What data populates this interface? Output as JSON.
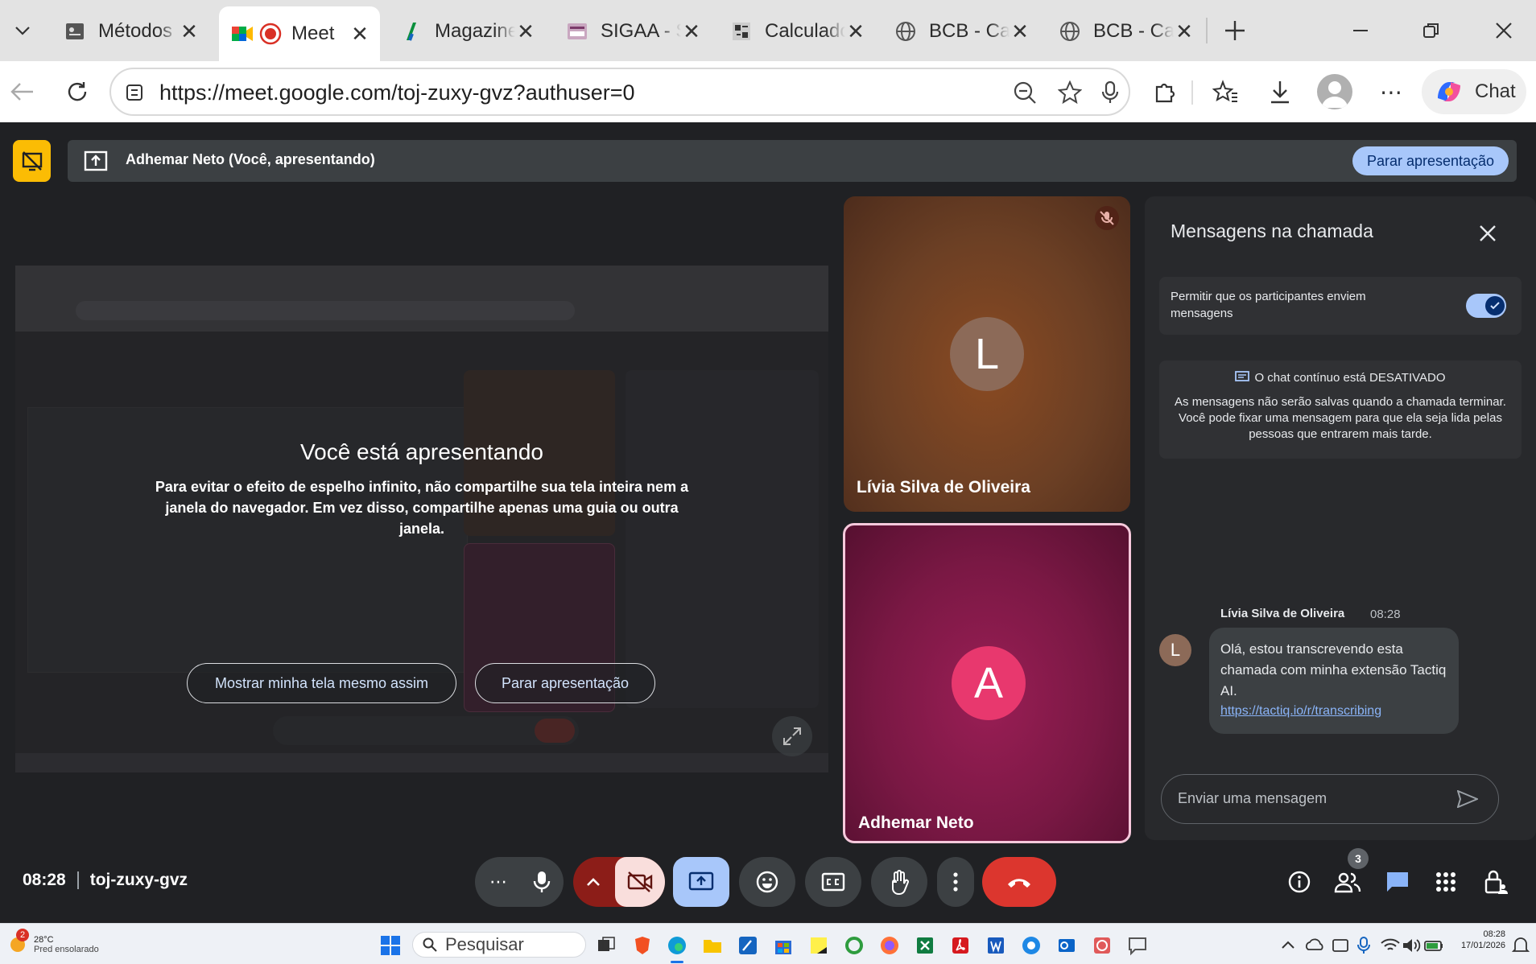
{
  "browser": {
    "tabs": [
      {
        "title": "Métodos",
        "icon": "document-icon"
      },
      {
        "title": "Meet",
        "icon": "meet-icon"
      },
      {
        "title": "Magazine",
        "icon": "magazine-icon"
      },
      {
        "title": "SIGAA - S",
        "icon": "sigaa-icon"
      },
      {
        "title": "Calculado",
        "icon": "calculator-icon"
      },
      {
        "title": "BCB - Cal",
        "icon": "globe-icon"
      },
      {
        "title": "BCB - Cal",
        "icon": "globe-icon"
      }
    ],
    "url": "https://meet.google.com/toj-zuxy-gvz?authuser=0",
    "chat_label": "Chat"
  },
  "meet": {
    "presenter_banner": "Adhemar Neto (Você, apresentando)",
    "stop_presenting": "Parar apresentação",
    "overlay": {
      "title": "Você está apresentando",
      "body": "Para evitar o efeito de espelho infinito, não compartilhe sua tela inteira nem a janela do navegador. Em vez disso, compartilhe apenas uma guia ou outra janela.",
      "show_anyway": "Mostrar minha tela mesmo assim",
      "stop": "Parar apresentação"
    },
    "participants": [
      {
        "name": "Lívia Silva de Oliveira",
        "initial": "L",
        "muted": true,
        "color": "#6b3f24"
      },
      {
        "name": "Adhemar Neto",
        "initial": "A",
        "muted": false,
        "color": "#e8386e"
      }
    ],
    "chat": {
      "title": "Mensagens na chamada",
      "allow_label": "Permitir que os participantes enviem mensagens",
      "allow_on": true,
      "continuous_title": "O chat contínuo está DESATIVADO",
      "continuous_body": "As mensagens não serão salvas quando a chamada terminar. Você pode fixar uma mensagem para que ela seja lida pelas pessoas que entrarem mais tarde.",
      "messages": [
        {
          "sender": "Lívia Silva de Oliveira",
          "time": "08:28",
          "initial": "L",
          "text": "Olá, estou transcrevendo esta chamada com minha extensão Tactiq AI.",
          "link": "https://tactiq.io/r/transcribing"
        }
      ],
      "input_placeholder": "Enviar uma mensagem"
    },
    "footer": {
      "time": "08:28",
      "code": "toj-zuxy-gvz",
      "people_count": "3"
    }
  },
  "taskbar": {
    "weather_temp": "28°C",
    "weather_desc": "Pred ensolarado",
    "weather_badge": "2",
    "search": "Pesquisar",
    "clock_time": "08:28",
    "clock_date": "17/01/2026"
  }
}
